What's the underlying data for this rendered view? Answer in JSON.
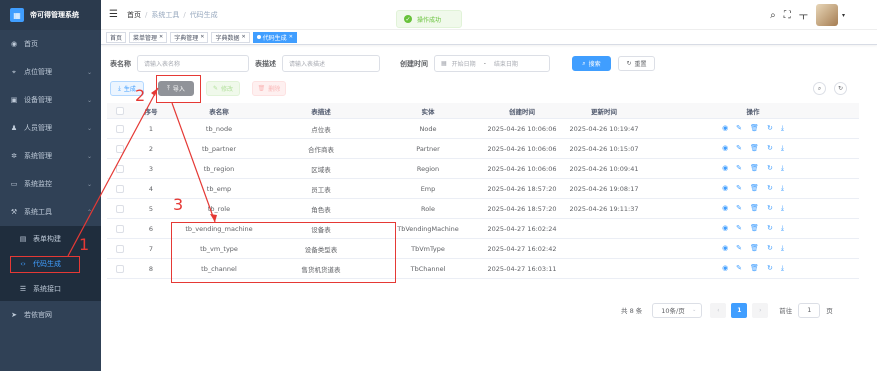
{
  "app": {
    "title": "帝可得管理系统"
  },
  "sidebar": {
    "items": [
      {
        "label": "首页",
        "icon": "dashboard-icon"
      },
      {
        "label": "点位管理",
        "icon": "location-icon"
      },
      {
        "label": "设备管理",
        "icon": "device-icon"
      },
      {
        "label": "人员管理",
        "icon": "user-icon"
      },
      {
        "label": "系统管理",
        "icon": "gear-icon"
      },
      {
        "label": "系统监控",
        "icon": "monitor-icon"
      },
      {
        "label": "系统工具",
        "icon": "tool-icon"
      }
    ],
    "submenu": [
      {
        "label": "表单构建",
        "icon": "form-icon"
      },
      {
        "label": "代码生成",
        "icon": "code-icon",
        "active": true
      },
      {
        "label": "系统接口",
        "icon": "api-icon"
      }
    ],
    "extra": {
      "label": "若依官网",
      "icon": "send-icon"
    }
  },
  "navbar": {
    "breadcrumb": [
      "首页",
      "系统工具",
      "代码生成"
    ],
    "toast": "操作成功"
  },
  "tags": [
    {
      "label": "首页",
      "closable": false
    },
    {
      "label": "菜单管理",
      "closable": true
    },
    {
      "label": "字典管理",
      "closable": true
    },
    {
      "label": "字典数据",
      "closable": true
    },
    {
      "label": "代码生成",
      "closable": true,
      "active": true
    }
  ],
  "search": {
    "table_name_label": "表名称",
    "table_name_placeholder": "请输入表名称",
    "table_desc_label": "表描述",
    "table_desc_placeholder": "请输入表描述",
    "create_time_label": "创建时间",
    "start_placeholder": "开始日期",
    "range_sep": "-",
    "end_placeholder": "结束日期",
    "search_btn": "搜索",
    "reset_btn": "重置"
  },
  "toolbar": {
    "generate": "生成",
    "import": "导入",
    "edit": "修改",
    "delete": "删除"
  },
  "table": {
    "headers": [
      "序号",
      "表名称",
      "表描述",
      "实体",
      "创建时间",
      "更新时间",
      "操作"
    ],
    "rows": [
      {
        "no": "1",
        "name": "tb_node",
        "desc": "点位表",
        "class": "Node",
        "created": "2025-04-26 10:06:06",
        "updated": "2025-04-26 10:19:47"
      },
      {
        "no": "2",
        "name": "tb_partner",
        "desc": "合作商表",
        "class": "Partner",
        "created": "2025-04-26 10:06:06",
        "updated": "2025-04-26 10:15:07"
      },
      {
        "no": "3",
        "name": "tb_region",
        "desc": "区域表",
        "class": "Region",
        "created": "2025-04-26 10:06:06",
        "updated": "2025-04-26 10:09:41"
      },
      {
        "no": "4",
        "name": "tb_emp",
        "desc": "员工表",
        "class": "Emp",
        "created": "2025-04-26 18:57:20",
        "updated": "2025-04-26 19:08:17"
      },
      {
        "no": "5",
        "name": "tb_role",
        "desc": "角色表",
        "class": "Role",
        "created": "2025-04-26 18:57:20",
        "updated": "2025-04-26 19:11:37"
      },
      {
        "no": "6",
        "name": "tb_vending_machine",
        "desc": "设备表",
        "class": "TbVendingMachine",
        "created": "2025-04-27 16:02:24",
        "updated": ""
      },
      {
        "no": "7",
        "name": "tb_vm_type",
        "desc": "设备类型表",
        "class": "TbVmType",
        "created": "2025-04-27 16:02:42",
        "updated": ""
      },
      {
        "no": "8",
        "name": "tb_channel",
        "desc": "售货机货道表",
        "class": "TbChannel",
        "created": "2025-04-27 16:03:11",
        "updated": ""
      }
    ]
  },
  "pagination": {
    "total": "共 8 条",
    "page_size": "10条/页",
    "current": "1",
    "goto_label": "前往",
    "goto_value": "1",
    "page_unit": "页"
  },
  "annotations": [
    "1",
    "2",
    "3"
  ],
  "colors": {
    "primary": "#409eff",
    "sidebar": "#304156",
    "annotation": "#e53935"
  }
}
